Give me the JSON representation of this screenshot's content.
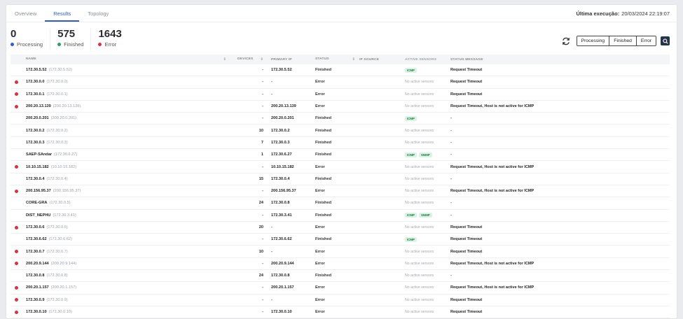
{
  "tabs": [
    {
      "label": "Overview",
      "active": false
    },
    {
      "label": "Results",
      "active": true
    },
    {
      "label": "Topology",
      "active": false
    }
  ],
  "last_execution": {
    "label": "Última execução:",
    "value": "20/03/2024 22:19:07"
  },
  "stats": [
    {
      "value": "0",
      "label": "Processing",
      "color": "#2f5bd3"
    },
    {
      "value": "575",
      "label": "Finished",
      "color": "#27a35a"
    },
    {
      "value": "1643",
      "label": "Error",
      "color": "#d8323c"
    }
  ],
  "filters": [
    "Processing",
    "Finished",
    "Error"
  ],
  "columns": {
    "name": "Name",
    "devices": "Devices",
    "primary_ip": "Primary IP",
    "status": "Status",
    "ip_source": "IP Source",
    "active_sensors": "Active Sensors",
    "status_message": "Status Message"
  },
  "colors": {
    "error_dot": "#d8323c",
    "badge_bg": "#d9f3e4",
    "badge_fg": "#1d7a45"
  },
  "rows": [
    {
      "name": "172.30.5.52",
      "ip": "(172.30.5.52)",
      "devices": "-",
      "primary_ip": "172.30.5.52",
      "status": "Finished",
      "sensors": [
        "ICMP"
      ],
      "message": "Request Timeout"
    },
    {
      "name": "172.30.0.0",
      "ip": "(172.30.0.0)",
      "devices": "-",
      "primary_ip": "-",
      "status": "Error",
      "sensors": [],
      "message": "Request Timeout"
    },
    {
      "name": "172.30.0.1",
      "ip": "(172.30.0.1)",
      "devices": "-",
      "primary_ip": "-",
      "status": "Error",
      "sensors": [],
      "message": "Request Timeout"
    },
    {
      "name": "200.20.13.139",
      "ip": "(200.20.13.139)",
      "devices": "-",
      "primary_ip": "200.20.13.139",
      "status": "Error",
      "sensors": [],
      "message": "Request Timeout, Host is not active for ICMP"
    },
    {
      "name": "200.20.0.201",
      "ip": "(200.20.0.201)",
      "devices": "-",
      "primary_ip": "200.20.0.201",
      "status": "Finished",
      "sensors": [
        "ICMP"
      ],
      "message": "-"
    },
    {
      "name": "172.30.0.2",
      "ip": "(172.30.0.2)",
      "devices": "10",
      "primary_ip": "172.30.0.2",
      "status": "Finished",
      "sensors": [],
      "message": "-"
    },
    {
      "name": "172.30.0.3",
      "ip": "(172.30.0.3)",
      "devices": "7",
      "primary_ip": "172.30.0.3",
      "status": "Finished",
      "sensors": [],
      "message": "-"
    },
    {
      "name": "SAEP-SAndar",
      "ip": "(172.30.6.27)",
      "devices": "1",
      "primary_ip": "172.30.6.27",
      "status": "Finished",
      "sensors": [
        "ICMP",
        "SNMP"
      ],
      "message": "-"
    },
    {
      "name": "10.10.15.182",
      "ip": "(10.10.15.182)",
      "devices": "-",
      "primary_ip": "10.10.15.182",
      "status": "Error",
      "sensors": [],
      "message": "Request Timeout, Host is not active for ICMP"
    },
    {
      "name": "172.30.0.4",
      "ip": "(172.30.0.4)",
      "devices": "15",
      "primary_ip": "172.30.0.4",
      "status": "Finished",
      "sensors": [],
      "message": "-"
    },
    {
      "name": "200.156.95.37",
      "ip": "(200.156.95.37)",
      "devices": "-",
      "primary_ip": "200.156.95.37",
      "status": "Error",
      "sensors": [],
      "message": "Request Timeout, Host is not active for ICMP"
    },
    {
      "name": "CORE-GRA",
      "ip": "(172.30.0.5)",
      "devices": "24",
      "primary_ip": "172.30.0.8",
      "status": "Finished",
      "sensors": [],
      "message": "-"
    },
    {
      "name": "DIST_NEPHU",
      "ip": "(172.30.3.41)",
      "devices": "-",
      "primary_ip": "172.30.3.41",
      "status": "Finished",
      "sensors": [
        "ICMP",
        "SNMP"
      ],
      "message": "-"
    },
    {
      "name": "172.30.0.6",
      "ip": "(172.30.0.6)",
      "devices": "20",
      "primary_ip": "-",
      "status": "Error",
      "sensors": [],
      "message": "Request Timeout"
    },
    {
      "name": "172.30.6.62",
      "ip": "(172.30.6.62)",
      "devices": "-",
      "primary_ip": "172.30.6.62",
      "status": "Finished",
      "sensors": [
        "ICMP"
      ],
      "message": "Request Timeout"
    },
    {
      "name": "172.30.0.7",
      "ip": "(172.30.0.7)",
      "devices": "10",
      "primary_ip": "-",
      "status": "Error",
      "sensors": [],
      "message": "Request Timeout"
    },
    {
      "name": "200.20.9.144",
      "ip": "(200.20.9.144)",
      "devices": "-",
      "primary_ip": "200.20.9.144",
      "status": "Error",
      "sensors": [],
      "message": "Request Timeout, Host is not active for ICMP"
    },
    {
      "name": "172.30.0.8",
      "ip": "(172.30.0.8)",
      "devices": "24",
      "primary_ip": "172.30.0.8",
      "status": "Finished",
      "sensors": [],
      "message": "-"
    },
    {
      "name": "200.20.1.157",
      "ip": "(200.20.1.157)",
      "devices": "-",
      "primary_ip": "200.20.1.157",
      "status": "Error",
      "sensors": [],
      "message": "Request Timeout, Host is not active for ICMP"
    },
    {
      "name": "172.30.0.9",
      "ip": "(172.30.0.9)",
      "devices": "-",
      "primary_ip": "-",
      "status": "Error",
      "sensors": [],
      "message": "Request Timeout"
    },
    {
      "name": "172.30.0.10",
      "ip": "(172.30.0.10)",
      "devices": "-",
      "primary_ip": "172.30.0.10",
      "status": "Error",
      "sensors": [],
      "message": "Request Timeout"
    }
  ],
  "no_sensors_text": "No active sensors"
}
